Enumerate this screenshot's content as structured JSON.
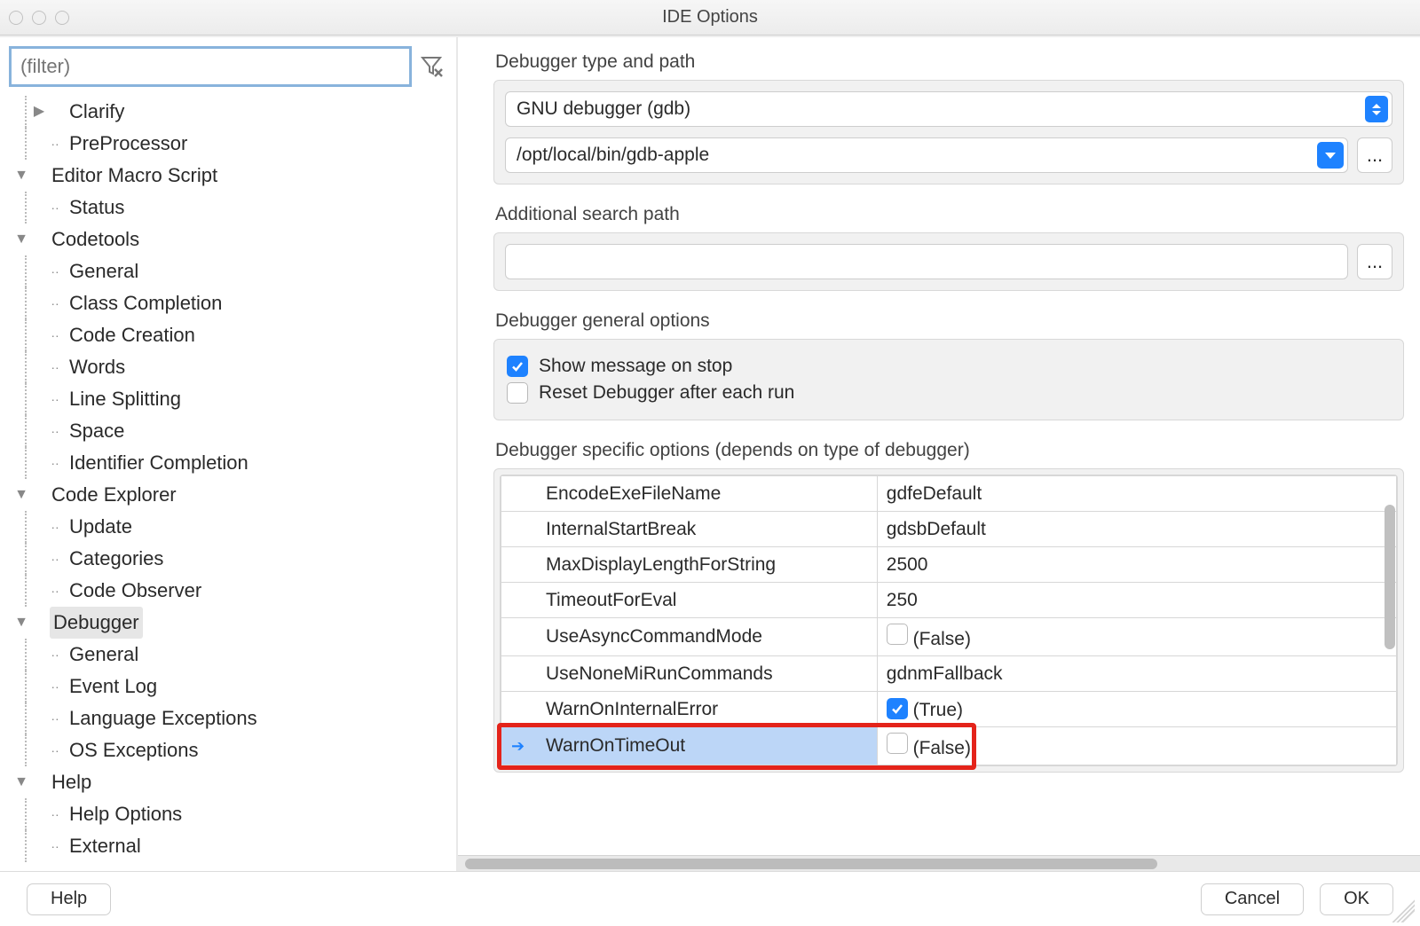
{
  "titlebar": {
    "title": "IDE Options"
  },
  "filter": {
    "placeholder": "(filter)"
  },
  "tree": {
    "items": [
      {
        "depth": 1,
        "toggle": "right",
        "mark": "",
        "label": "Clarify"
      },
      {
        "depth": 1,
        "toggle": "",
        "mark": "leaf",
        "label": "PreProcessor"
      },
      {
        "depth": 0,
        "toggle": "down",
        "mark": "",
        "label": "Editor Macro Script"
      },
      {
        "depth": 1,
        "toggle": "",
        "mark": "leaf",
        "label": "Status"
      },
      {
        "depth": 0,
        "toggle": "down",
        "mark": "",
        "label": "Codetools"
      },
      {
        "depth": 1,
        "toggle": "",
        "mark": "mid",
        "label": "General"
      },
      {
        "depth": 1,
        "toggle": "",
        "mark": "mid",
        "label": "Class Completion"
      },
      {
        "depth": 1,
        "toggle": "",
        "mark": "mid",
        "label": "Code Creation"
      },
      {
        "depth": 1,
        "toggle": "",
        "mark": "mid",
        "label": "Words"
      },
      {
        "depth": 1,
        "toggle": "",
        "mark": "mid",
        "label": "Line Splitting"
      },
      {
        "depth": 1,
        "toggle": "",
        "mark": "mid",
        "label": "Space"
      },
      {
        "depth": 1,
        "toggle": "",
        "mark": "leaf",
        "label": "Identifier Completion"
      },
      {
        "depth": 0,
        "toggle": "down",
        "mark": "",
        "label": "Code Explorer"
      },
      {
        "depth": 1,
        "toggle": "",
        "mark": "mid",
        "label": "Update"
      },
      {
        "depth": 1,
        "toggle": "",
        "mark": "mid",
        "label": "Categories"
      },
      {
        "depth": 1,
        "toggle": "",
        "mark": "leaf",
        "label": "Code Observer"
      },
      {
        "depth": 0,
        "toggle": "down",
        "mark": "",
        "label": "Debugger",
        "selected": true
      },
      {
        "depth": 1,
        "toggle": "",
        "mark": "mid",
        "label": "General"
      },
      {
        "depth": 1,
        "toggle": "",
        "mark": "mid",
        "label": "Event Log"
      },
      {
        "depth": 1,
        "toggle": "",
        "mark": "mid",
        "label": "Language Exceptions"
      },
      {
        "depth": 1,
        "toggle": "",
        "mark": "leaf",
        "label": "OS Exceptions"
      },
      {
        "depth": 0,
        "toggle": "down",
        "mark": "",
        "label": "Help"
      },
      {
        "depth": 1,
        "toggle": "",
        "mark": "mid",
        "label": "Help Options"
      },
      {
        "depth": 1,
        "toggle": "",
        "mark": "leaf",
        "label": "External"
      }
    ]
  },
  "sections": {
    "typepath": {
      "title": "Debugger type and path",
      "type_value": "GNU debugger (gdb)",
      "path_value": "/opt/local/bin/gdb-apple",
      "ellipsis": "..."
    },
    "addsearch": {
      "title": "Additional search path",
      "value": "",
      "ellipsis": "..."
    },
    "general": {
      "title": "Debugger general options",
      "show_msg": {
        "label": "Show message on stop",
        "checked": true
      },
      "reset": {
        "label": "Reset Debugger after each run",
        "checked": false
      }
    },
    "specific": {
      "title": "Debugger specific options (depends on type of debugger)",
      "rows": [
        {
          "key": "EncodeExeFileName",
          "value": "gdfeDefault",
          "type": "text"
        },
        {
          "key": "InternalStartBreak",
          "value": "gdsbDefault",
          "type": "text"
        },
        {
          "key": "MaxDisplayLengthForString",
          "value": "2500",
          "type": "text"
        },
        {
          "key": "TimeoutForEval",
          "value": "250",
          "type": "text"
        },
        {
          "key": "UseAsyncCommandMode",
          "value": "(False)",
          "type": "check",
          "checked": false
        },
        {
          "key": "UseNoneMiRunCommands",
          "value": "gdnmFallback",
          "type": "text"
        },
        {
          "key": "WarnOnInternalError",
          "value": "(True)",
          "type": "check",
          "checked": true
        },
        {
          "key": "WarnOnTimeOut",
          "value": "(False)",
          "type": "check",
          "checked": false,
          "selected": true
        }
      ]
    }
  },
  "buttons": {
    "help": "Help",
    "cancel": "Cancel",
    "ok": "OK"
  }
}
